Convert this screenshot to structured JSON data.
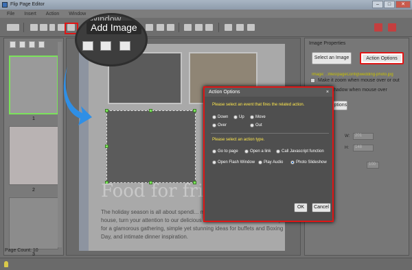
{
  "window": {
    "title": "Flip Page Editor",
    "controls": [
      "–",
      "□",
      "✕"
    ]
  },
  "menu": {
    "items": [
      "File",
      "Insert",
      "Action",
      "Window"
    ]
  },
  "tooltip": {
    "label": "Add Image",
    "window_label": "Window"
  },
  "thumbs": {
    "pages": [
      "1",
      "2",
      "3"
    ],
    "page_count": "Page Count: 10"
  },
  "page": {
    "title": "Food for frie",
    "body": "The holiday season is all about spendi... make this year really special. Once ... house, turn your attention to our delicious food. We've cocktails and canapés for a glamorous gathering, simple yet stunning ideas for buffets and Boxing Day, and intimate dinner inspiration."
  },
  "props": {
    "heading": "Image Properties",
    "select_image": "Select an Image",
    "action_options": "Action Options",
    "path": "Image: ..\\files\\pageConfig\\wedding-photo.jpg",
    "zoom_check": "Make it zoom when mouse over or out",
    "shadow_check": "Show shadow when mouse over",
    "options_btn": "Options",
    "w_label": "W:",
    "h_label": "H:",
    "w_value": "201",
    "h_value": "148",
    "alpha_value": "100"
  },
  "dialog": {
    "title": "Action Options",
    "close": "×",
    "event_prompt": "Please select an event that fires the related action.",
    "events": [
      "Down",
      "Up",
      "Move",
      "Over",
      "Out"
    ],
    "action_prompt": "Please select an action type.",
    "actions": [
      "Go to page",
      "Open a link",
      "Call Javascript function",
      "Open Flash Window",
      "Play Audio",
      "Photo Slideshow"
    ],
    "selected_action": "Photo Slideshow",
    "ok": "OK",
    "cancel": "Cancel"
  },
  "colors": {
    "highlight": "#e01515",
    "prompt": "#ffe84d",
    "selection": "#7be35a",
    "arrow": "#2f8fe6"
  }
}
